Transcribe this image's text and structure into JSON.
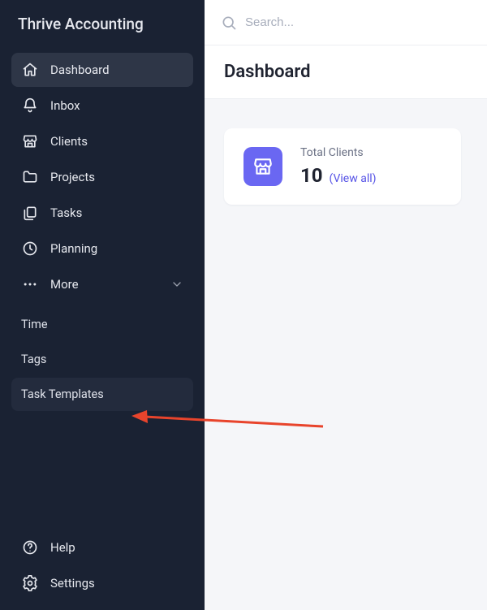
{
  "brand": "Thrive Accounting",
  "sidebar": {
    "items": [
      {
        "label": "Dashboard"
      },
      {
        "label": "Inbox"
      },
      {
        "label": "Clients"
      },
      {
        "label": "Projects"
      },
      {
        "label": "Tasks"
      },
      {
        "label": "Planning"
      },
      {
        "label": "More"
      }
    ],
    "more_sub": [
      {
        "label": "Time"
      },
      {
        "label": "Tags"
      },
      {
        "label": "Task Templates"
      }
    ],
    "bottom": [
      {
        "label": "Help"
      },
      {
        "label": "Settings"
      }
    ]
  },
  "search": {
    "placeholder": "Search..."
  },
  "page": {
    "title": "Dashboard"
  },
  "card": {
    "label": "Total Clients",
    "value": "10",
    "link": "(View all)"
  }
}
